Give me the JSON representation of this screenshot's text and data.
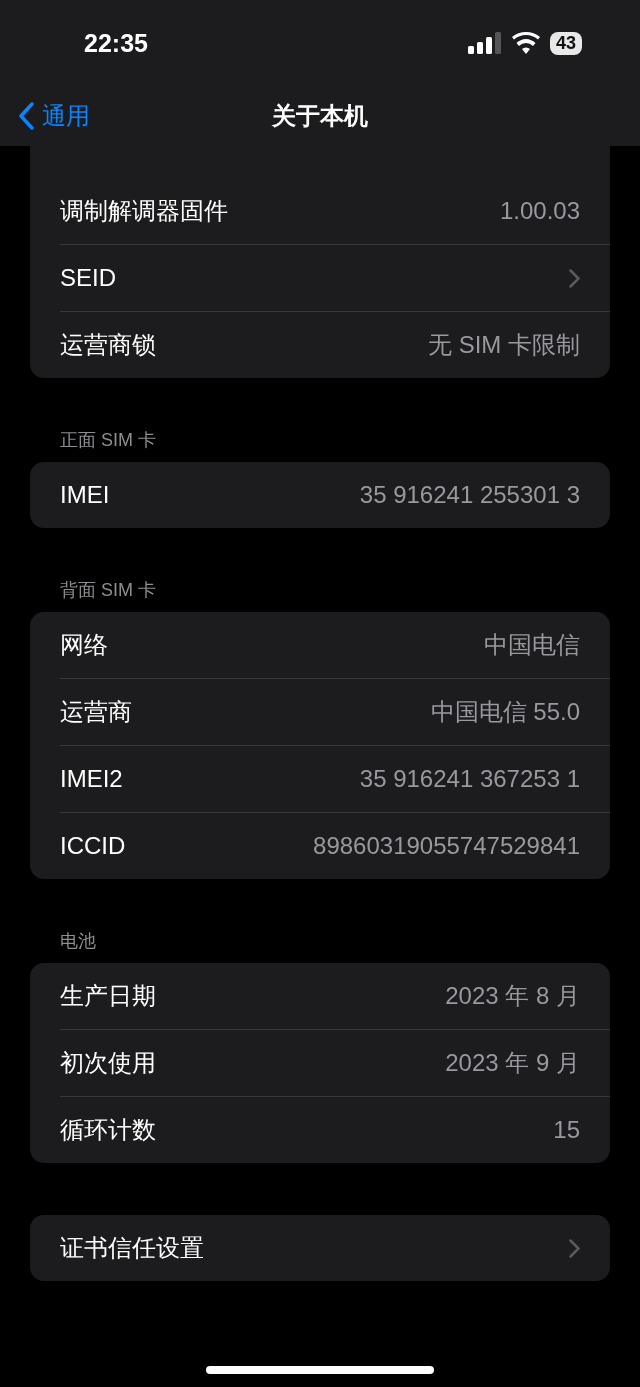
{
  "status_bar": {
    "time": "22:35",
    "battery": "43"
  },
  "nav": {
    "back": "通用",
    "title": "关于本机"
  },
  "sections": [
    {
      "rows": [
        {
          "label": "调制解调器固件",
          "value": "1.00.03",
          "chevron": false
        },
        {
          "label": "SEID",
          "chevron": true
        },
        {
          "label": "运营商锁",
          "value": "无 SIM 卡限制",
          "chevron": false
        }
      ]
    },
    {
      "header": "正面 SIM 卡",
      "rows": [
        {
          "label": "IMEI",
          "value": "35 916241 255301 3",
          "chevron": false
        }
      ]
    },
    {
      "header": "背面 SIM 卡",
      "rows": [
        {
          "label": "网络",
          "value": "中国电信",
          "chevron": false
        },
        {
          "label": "运营商",
          "value": "中国电信 55.0",
          "chevron": false
        },
        {
          "label": "IMEI2",
          "value": "35 916241 367253 1",
          "chevron": false
        },
        {
          "label": "ICCID",
          "value": "89860319055747529841",
          "chevron": false
        }
      ]
    },
    {
      "header": "电池",
      "rows": [
        {
          "label": "生产日期",
          "value": "2023 年 8 月",
          "chevron": false
        },
        {
          "label": "初次使用",
          "value": "2023 年 9 月",
          "chevron": false
        },
        {
          "label": "循环计数",
          "value": "15",
          "chevron": false
        }
      ]
    },
    {
      "rows": [
        {
          "label": "证书信任设置",
          "chevron": true
        }
      ]
    }
  ]
}
